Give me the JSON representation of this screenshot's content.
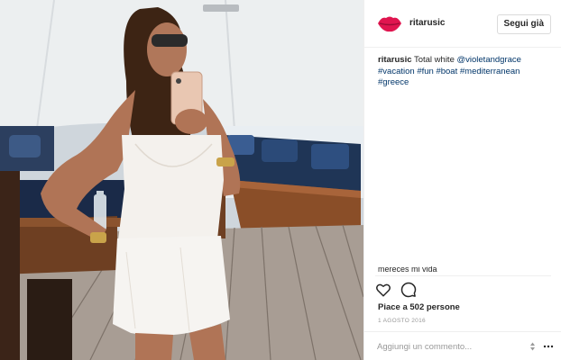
{
  "post": {
    "username": "ritarusic",
    "follow_label": "Segui già",
    "caption": {
      "user": "ritarusic",
      "text": "Total white",
      "mention": "@violetandgrace",
      "hashtags": [
        "#vacation",
        "#fun",
        "#boat",
        "#mediterranean",
        "#greece"
      ]
    },
    "partial_comment": "mereces mi vida",
    "likes": "Piace a 502 persone",
    "date": "1 AGOSTO 2016",
    "comment_placeholder": "Aggiungi un commento..."
  },
  "icons": {
    "avatar": "red-lips-icon",
    "like": "heart-icon",
    "comment": "comment-icon",
    "stepper": "stepper-icon",
    "more": "more-icon"
  },
  "colors": {
    "hashtag": "#003569",
    "avatar_lips": "#e0154f",
    "border": "#efefef",
    "muted": "#999999"
  }
}
